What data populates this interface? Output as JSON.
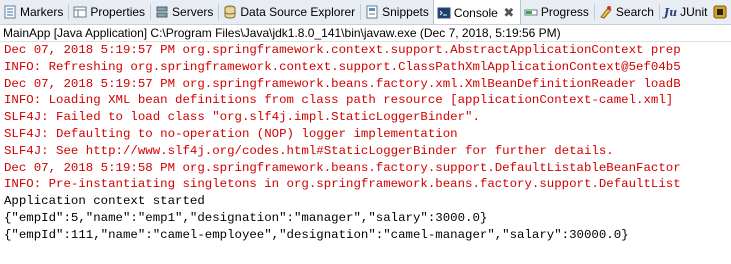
{
  "tabs": [
    {
      "label": "Markers",
      "icon": "markers-icon"
    },
    {
      "label": "Properties",
      "icon": "properties-icon"
    },
    {
      "label": "Servers",
      "icon": "servers-icon"
    },
    {
      "label": "Data Source Explorer",
      "icon": "data-source-explorer-icon"
    },
    {
      "label": "Snippets",
      "icon": "snippets-icon"
    },
    {
      "label": "Console",
      "icon": "console-icon",
      "active": true,
      "close": "✖"
    },
    {
      "label": "Progress",
      "icon": "progress-icon"
    },
    {
      "label": "Search",
      "icon": "search-icon"
    },
    {
      "label": "JUnit",
      "icon": "junit-icon",
      "icon_text": "Ju"
    }
  ],
  "console": {
    "title": "MainApp [Java Application] C:\\Program Files\\Java\\jdk1.8.0_141\\bin\\javaw.exe (Dec 7, 2018, 5:19:56 PM)",
    "lines": [
      {
        "text": "Dec 07, 2018 5:19:57 PM org.springframework.context.support.AbstractApplicationContext prep",
        "stream": "err"
      },
      {
        "text": "INFO: Refreshing org.springframework.context.support.ClassPathXmlApplicationContext@5ef04b5",
        "stream": "err"
      },
      {
        "text": "Dec 07, 2018 5:19:57 PM org.springframework.beans.factory.xml.XmlBeanDefinitionReader loadB",
        "stream": "err"
      },
      {
        "text": "INFO: Loading XML bean definitions from class path resource [applicationContext-camel.xml]",
        "stream": "err"
      },
      {
        "text": "SLF4J: Failed to load class \"org.slf4j.impl.StaticLoggerBinder\".",
        "stream": "err"
      },
      {
        "text": "SLF4J: Defaulting to no-operation (NOP) logger implementation",
        "stream": "err"
      },
      {
        "text": "SLF4J: See http://www.slf4j.org/codes.html#StaticLoggerBinder for further details.",
        "stream": "err"
      },
      {
        "text": "Dec 07, 2018 5:19:58 PM org.springframework.beans.factory.support.DefaultListableBeanFactor",
        "stream": "err"
      },
      {
        "text": "INFO: Pre-instantiating singletons in org.springframework.beans.factory.support.DefaultList",
        "stream": "err"
      },
      {
        "text": "Application context started",
        "stream": "out"
      },
      {
        "text": "{\"empId\":5,\"name\":\"emp1\",\"designation\":\"manager\",\"salary\":3000.0}",
        "stream": "out"
      },
      {
        "text": "{\"empId\":111,\"name\":\"camel-employee\",\"designation\":\"camel-manager\",\"salary\":30000.0}",
        "stream": "out"
      }
    ]
  },
  "colors": {
    "stderr": "#d20000",
    "stdout": "#000000",
    "tabbar_bg": "#e8edf3"
  }
}
